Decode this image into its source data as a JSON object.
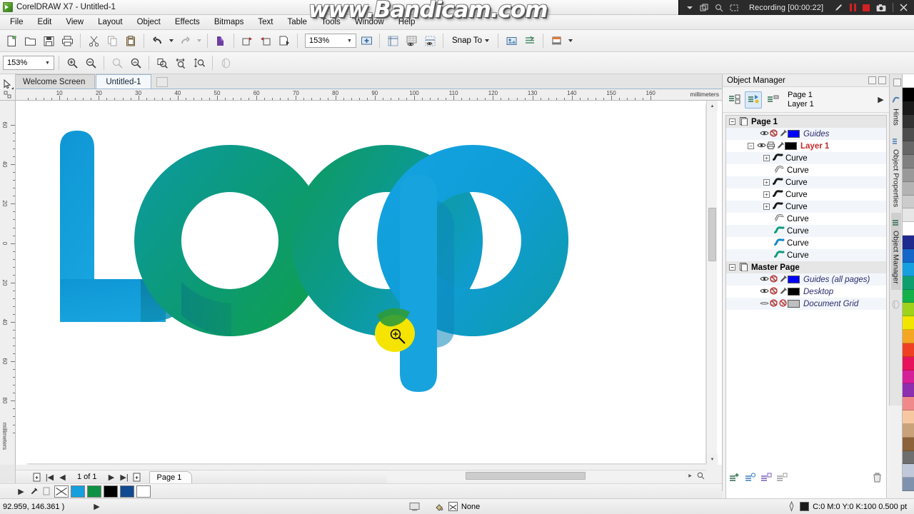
{
  "window": {
    "title": "CorelDRAW X7 - Untitled-1",
    "app_icon": "coreldraw-icon"
  },
  "recorder": {
    "label": "Recording [00:00:22]",
    "watermark": "www.Bandicam.com",
    "icons": [
      "chevron-down-icon",
      "window-icon",
      "magnifier-icon",
      "region-icon",
      "pencil-icon",
      "pause-icon",
      "stop-icon",
      "camera-icon",
      "close-icon"
    ]
  },
  "menubar": {
    "items": [
      "File",
      "Edit",
      "View",
      "Layout",
      "Object",
      "Effects",
      "Bitmaps",
      "Text",
      "Table",
      "Tools",
      "Window",
      "Help"
    ]
  },
  "toolbar_main": {
    "zoom_value": "153%",
    "snap_to_label": "Snap To",
    "buttons": [
      "new-document-icon",
      "open-document-icon",
      "save-document-icon",
      "print-icon",
      "cut-icon",
      "copy-icon",
      "paste-icon",
      "undo-icon",
      "undo-dropdown-icon",
      "redo-icon",
      "redo-dropdown-icon",
      "search-content-icon",
      "import-icon",
      "export-icon",
      "publish-pdf-icon",
      "zoom-level-combo",
      "fullscreen-preview-icon",
      "show-rulers-icon",
      "show-grid-icon",
      "show-guides-icon",
      "snap-to-dropdown",
      "options-icon",
      "object-properties-icon",
      "application-launcher-icon"
    ]
  },
  "toolbar_zoom": {
    "zoom_value": "153%",
    "buttons": [
      "zoom-in-icon",
      "zoom-out-icon",
      "zoom-to-selection-icon",
      "zoom-to-all-objects-icon",
      "zoom-to-page-icon",
      "zoom-to-page-width-icon",
      "zoom-to-page-height-icon",
      "page-border-icon"
    ]
  },
  "document_tabs": {
    "tabs": [
      {
        "label": "Welcome Screen",
        "active": false
      },
      {
        "label": "Untitled-1",
        "active": true
      }
    ]
  },
  "toolbox": {
    "tools": [
      {
        "name": "pick-tool",
        "glyph": "➤",
        "flyout": true,
        "active": false
      },
      {
        "name": "shape-tool",
        "glyph": "⤵",
        "flyout": true,
        "active": false
      },
      {
        "name": "crop-tool",
        "glyph": "✄",
        "flyout": true,
        "active": false
      },
      {
        "name": "zoom-tool",
        "glyph": "🔍",
        "flyout": true,
        "active": true
      },
      {
        "name": "freehand-tool",
        "glyph": "∿",
        "flyout": true,
        "active": false
      },
      {
        "name": "artistic-media-tool",
        "glyph": "❧",
        "flyout": false,
        "active": false
      },
      {
        "name": "rectangle-tool",
        "glyph": "▭",
        "flyout": true,
        "active": false
      },
      {
        "name": "ellipse-tool",
        "glyph": "○",
        "flyout": true,
        "active": false
      },
      {
        "name": "polygon-tool",
        "glyph": "⬡",
        "flyout": true,
        "active": false
      },
      {
        "name": "text-tool",
        "glyph": "A",
        "flyout": true,
        "active": false
      },
      {
        "name": "parallel-dimension-tool",
        "glyph": "⤡",
        "flyout": true,
        "active": false
      },
      {
        "name": "straight-line-connector-tool",
        "glyph": "↗",
        "flyout": true,
        "active": false
      },
      {
        "name": "drop-shadow-tool",
        "glyph": "◰",
        "flyout": true,
        "active": false
      },
      {
        "name": "transparency-tool",
        "glyph": "◔",
        "flyout": false,
        "active": false
      },
      {
        "name": "color-eyedropper-tool",
        "glyph": "✒",
        "flyout": true,
        "active": false
      },
      {
        "name": "interactive-fill-tool",
        "glyph": "◆",
        "flyout": true,
        "active": false
      },
      {
        "name": "smart-fill-tool",
        "glyph": "❖",
        "flyout": false,
        "active": false
      },
      {
        "name": "outline-tool",
        "glyph": "▢",
        "flyout": false,
        "active": false
      }
    ]
  },
  "rulers": {
    "unit": "millimeters",
    "h_labels": [
      10,
      20,
      30,
      40,
      50,
      60,
      70,
      80,
      90,
      100,
      110,
      120,
      130,
      140,
      150,
      160
    ],
    "v_labels": [
      60,
      40,
      20,
      0,
      20,
      40,
      60,
      80
    ],
    "v_unit": "millimeters"
  },
  "canvas": {
    "artwork_name": "loop-logo-artwork",
    "colors": {
      "blue_start": "#0f9fe0",
      "blue_mid": "#0aa3dc",
      "teal": "#0b9a9c",
      "green": "#0f9b57",
      "green_dark": "#0a8f4d",
      "highlight_yellow": "#f5e400"
    },
    "cursor": "zoom-in-cursor"
  },
  "page_navigator": {
    "count_label": "1 of 1",
    "page_tab_label": "Page 1",
    "buttons": [
      "add-page-start-icon",
      "first-page-icon",
      "previous-page-icon",
      "next-page-icon",
      "last-page-icon",
      "add-page-end-icon"
    ]
  },
  "bottom_palette": {
    "swatches": [
      "none",
      "#159fdc",
      "#0f9145",
      "#000000",
      "#114a91",
      "#ffffff"
    ]
  },
  "docker": {
    "title": "Object Manager",
    "header_buttons": [
      "show-object-properties-icon",
      "edit-across-layers-icon",
      "layer-manager-view-icon"
    ],
    "page_label": "Page 1",
    "layer_label": "Layer 1",
    "tree": [
      {
        "type": "page",
        "label": "Page 1",
        "expander": "-",
        "icon": "page-icon",
        "indent": 0
      },
      {
        "type": "guides",
        "label": "Guides",
        "icon": "guides-icon",
        "color": "#0000ff",
        "indent": 1,
        "italic": true
      },
      {
        "type": "layer",
        "label": "Layer 1",
        "expander": "-",
        "icon": "layer-icon",
        "color": "#000000",
        "indent": 1,
        "red": true
      },
      {
        "type": "object",
        "label": "Curve",
        "expander": "+",
        "icon": "curve-icon",
        "indent": 2,
        "swatch": "#1a1a1a"
      },
      {
        "type": "object",
        "label": "Curve",
        "expander": "",
        "icon": "curve-outline-icon",
        "indent": 2,
        "swatch": "#ffffff"
      },
      {
        "type": "object",
        "label": "Curve",
        "expander": "+",
        "icon": "curve-icon",
        "indent": 2,
        "swatch": "#1a1a1a"
      },
      {
        "type": "object",
        "label": "Curve",
        "expander": "+",
        "icon": "curve-icon",
        "indent": 2,
        "swatch": "#1a1a1a"
      },
      {
        "type": "object",
        "label": "Curve",
        "expander": "+",
        "icon": "curve-icon",
        "indent": 2,
        "swatch": "#1a1a1a"
      },
      {
        "type": "object",
        "label": "Curve",
        "expander": "",
        "icon": "curve-outline-icon",
        "indent": 2,
        "swatch": "#ffffff"
      },
      {
        "type": "object",
        "label": "Curve",
        "expander": "",
        "icon": "curve-icon",
        "indent": 2,
        "swatch": "#0f9b7a"
      },
      {
        "type": "object",
        "label": "Curve",
        "expander": "",
        "icon": "curve-icon",
        "indent": 2,
        "swatch": "#1388c9"
      },
      {
        "type": "object",
        "label": "Curve",
        "expander": "",
        "icon": "curve-icon",
        "indent": 2,
        "swatch": "#0f9b7a"
      },
      {
        "type": "master",
        "label": "Master Page",
        "expander": "-",
        "icon": "master-page-icon",
        "indent": 0
      },
      {
        "type": "guides",
        "label": "Guides (all pages)",
        "icon": "guides-icon",
        "color": "#0000ff",
        "indent": 1,
        "italic": true
      },
      {
        "type": "desktop",
        "label": "Desktop",
        "icon": "desktop-icon",
        "color": "#000000",
        "indent": 1,
        "italic": true
      },
      {
        "type": "grid",
        "label": "Document Grid",
        "icon": "grid-icon",
        "color": "#bfbfbf",
        "indent": 1,
        "italic": true
      }
    ],
    "footer_buttons": [
      "new-layer-icon",
      "new-master-layer-icon",
      "new-master-layer-odd-icon",
      "new-master-layer-even-icon",
      "delete-icon"
    ]
  },
  "docker_tabs": {
    "tabs": [
      {
        "label": "Hints",
        "icon": "hints-icon",
        "selected": false
      },
      {
        "label": "Object Properties",
        "icon": "object-properties-icon",
        "selected": false
      },
      {
        "label": "Object Manager",
        "icon": "object-manager-icon",
        "selected": true
      }
    ]
  },
  "color_palette": {
    "colors": [
      "#ffffff",
      "#000000",
      "#1a1a1a",
      "#333333",
      "#4d4d4d",
      "#666666",
      "#808080",
      "#999999",
      "#b3b3b3",
      "#cccccc",
      "#e6e6e6",
      "#ffffff",
      "#1f2a8f",
      "#1466c8",
      "#16a0e0",
      "#0e9f6e",
      "#14b04a",
      "#9fd21a",
      "#f2e500",
      "#f5a623",
      "#ef4023",
      "#e8125c",
      "#d6209a",
      "#8e2fb0",
      "#f08a8a",
      "#f7c8a0",
      "#c9a27a",
      "#8c6239",
      "#6e6e6e",
      "#bfc9d9",
      "#7f92ad"
    ]
  },
  "statusbar": {
    "coordinates": "92.959, 146.361 )",
    "fill_label": "None",
    "outline_label": "C:0 M:0 Y:0 K:100  0.500 pt",
    "icons": [
      "screen-icon",
      "fill-color-icon",
      "no-fill-icon",
      "outline-pen-icon"
    ]
  }
}
